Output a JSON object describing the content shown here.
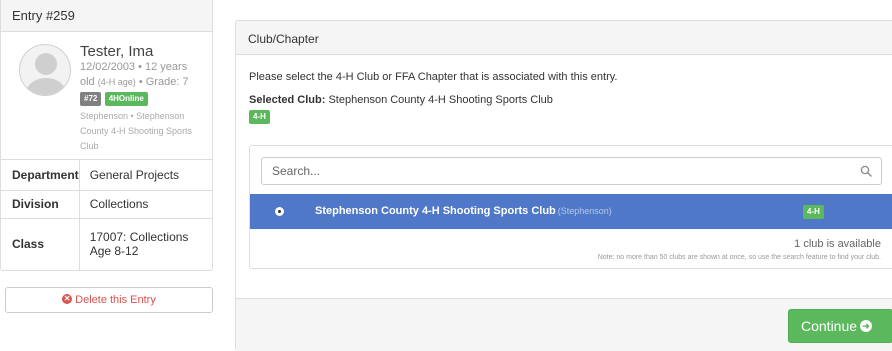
{
  "entry": {
    "title": "Entry #259"
  },
  "profile": {
    "name": "Tester, Ima",
    "dob_age": "12/02/2003 • 12 years",
    "age_prefix": "old",
    "age_note": "(4-H age)",
    "grade": "• Grade: 7",
    "badges": [
      "#72",
      "4HOnline"
    ],
    "address_line1": "Stephenson • Stephenson",
    "address_line2": "County 4-H Shooting Sports",
    "address_line3": "Club"
  },
  "details": [
    {
      "label": "Department",
      "value": "General Projects"
    },
    {
      "label": "Division",
      "value": "Collections"
    },
    {
      "label": "Class",
      "value": "17007: Collections Age 8-12"
    }
  ],
  "delete_label": "Delete this Entry",
  "club_panel": {
    "title": "Club/Chapter",
    "intro": "Please select the 4-H Club or FFA Chapter that is associated with this entry.",
    "selected_label": "Selected Club:",
    "selected_value": "Stephenson County 4-H Shooting Sports Club",
    "selected_badge": "4-H",
    "search_placeholder": "Search...",
    "clubs": [
      {
        "name": "Stephenson County 4-H Shooting Sports Club",
        "county": "(Stephenson)",
        "badge": "4-H",
        "selected": true
      }
    ],
    "available_text": "1 club is available",
    "note": "Note: no more than 50 clubs are shown at once, so use the search feature to find your club.",
    "continue_label": "Continue"
  },
  "colors": {
    "accent_blue": "#4f78c9",
    "success_green": "#5cb85c",
    "danger_red": "#d9534f"
  }
}
